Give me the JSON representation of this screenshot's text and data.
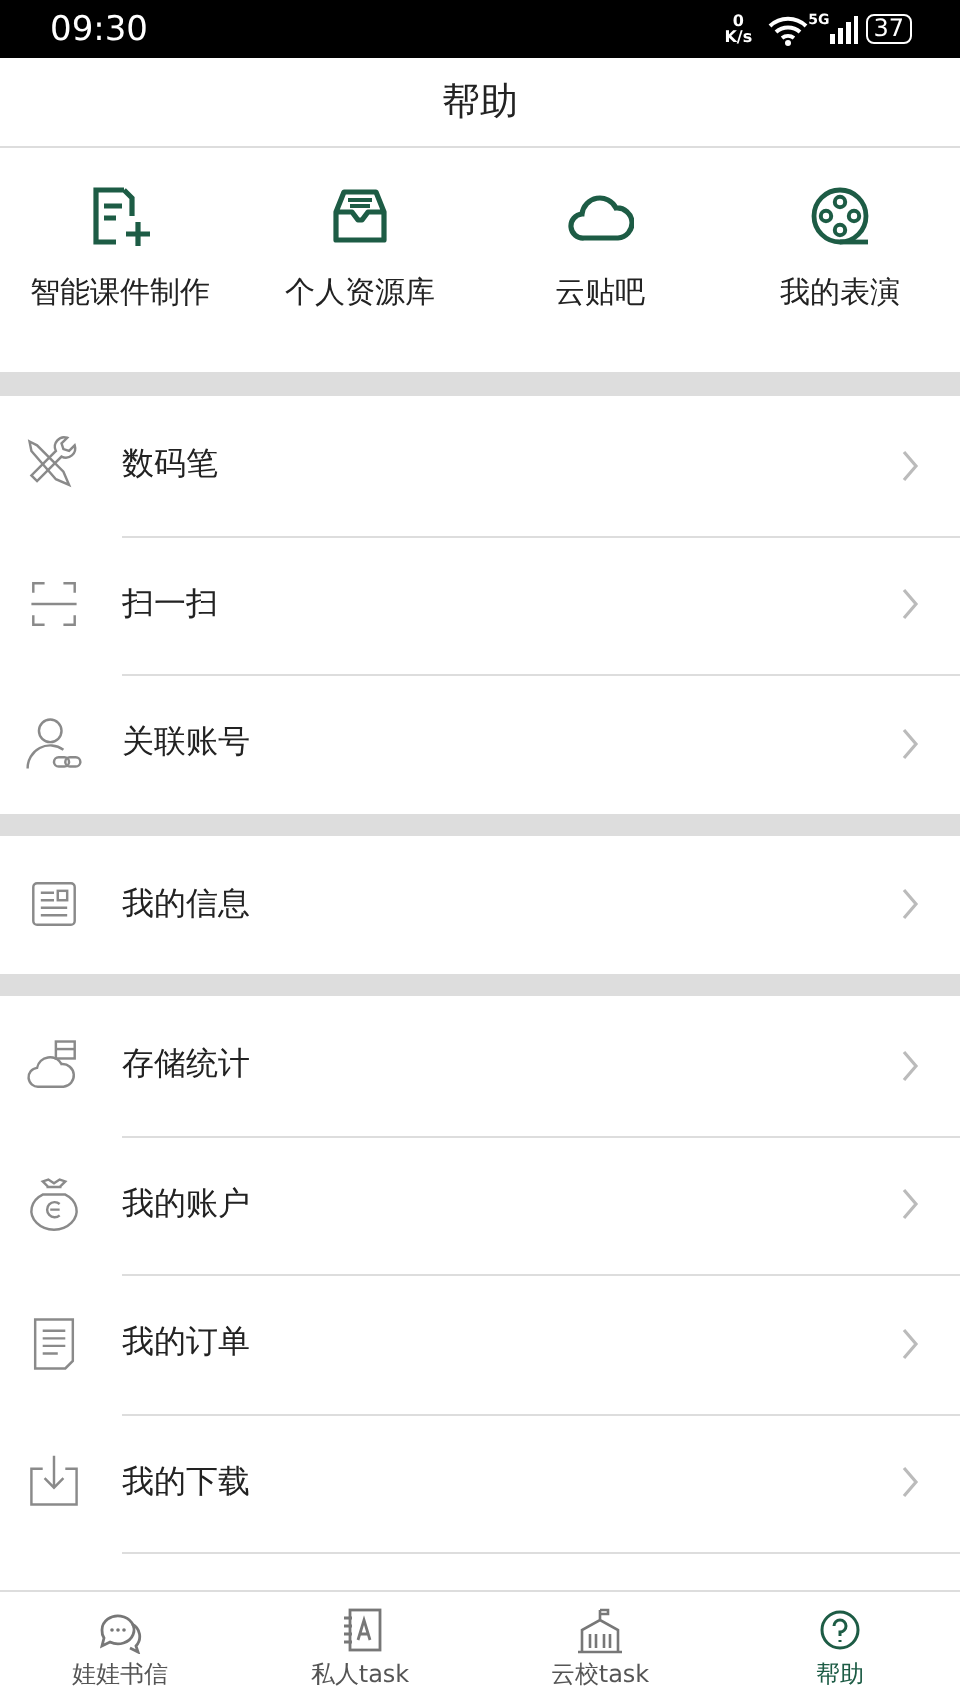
{
  "status_bar": {
    "time": "09:30",
    "speed_value": "0",
    "speed_unit": "K/s",
    "network": "5G",
    "battery": "37"
  },
  "header": {
    "title": "帮助"
  },
  "shortcuts": [
    {
      "label": "智能课件制作"
    },
    {
      "label": "个人资源库"
    },
    {
      "label": "云贴吧"
    },
    {
      "label": "我的表演"
    }
  ],
  "sections": [
    {
      "items": [
        {
          "label": "数码笔"
        },
        {
          "label": "扫一扫"
        },
        {
          "label": "关联账号"
        }
      ]
    },
    {
      "items": [
        {
          "label": "我的信息"
        }
      ]
    },
    {
      "items": [
        {
          "label": "存储统计"
        },
        {
          "label": "我的账户"
        },
        {
          "label": "我的订单"
        },
        {
          "label": "我的下载"
        }
      ]
    }
  ],
  "tab_bar": [
    {
      "label": "娃娃书信",
      "selected": false
    },
    {
      "label": "私人task",
      "selected": false
    },
    {
      "label": "云校task",
      "selected": false
    },
    {
      "label": "帮助",
      "selected": true
    }
  ]
}
